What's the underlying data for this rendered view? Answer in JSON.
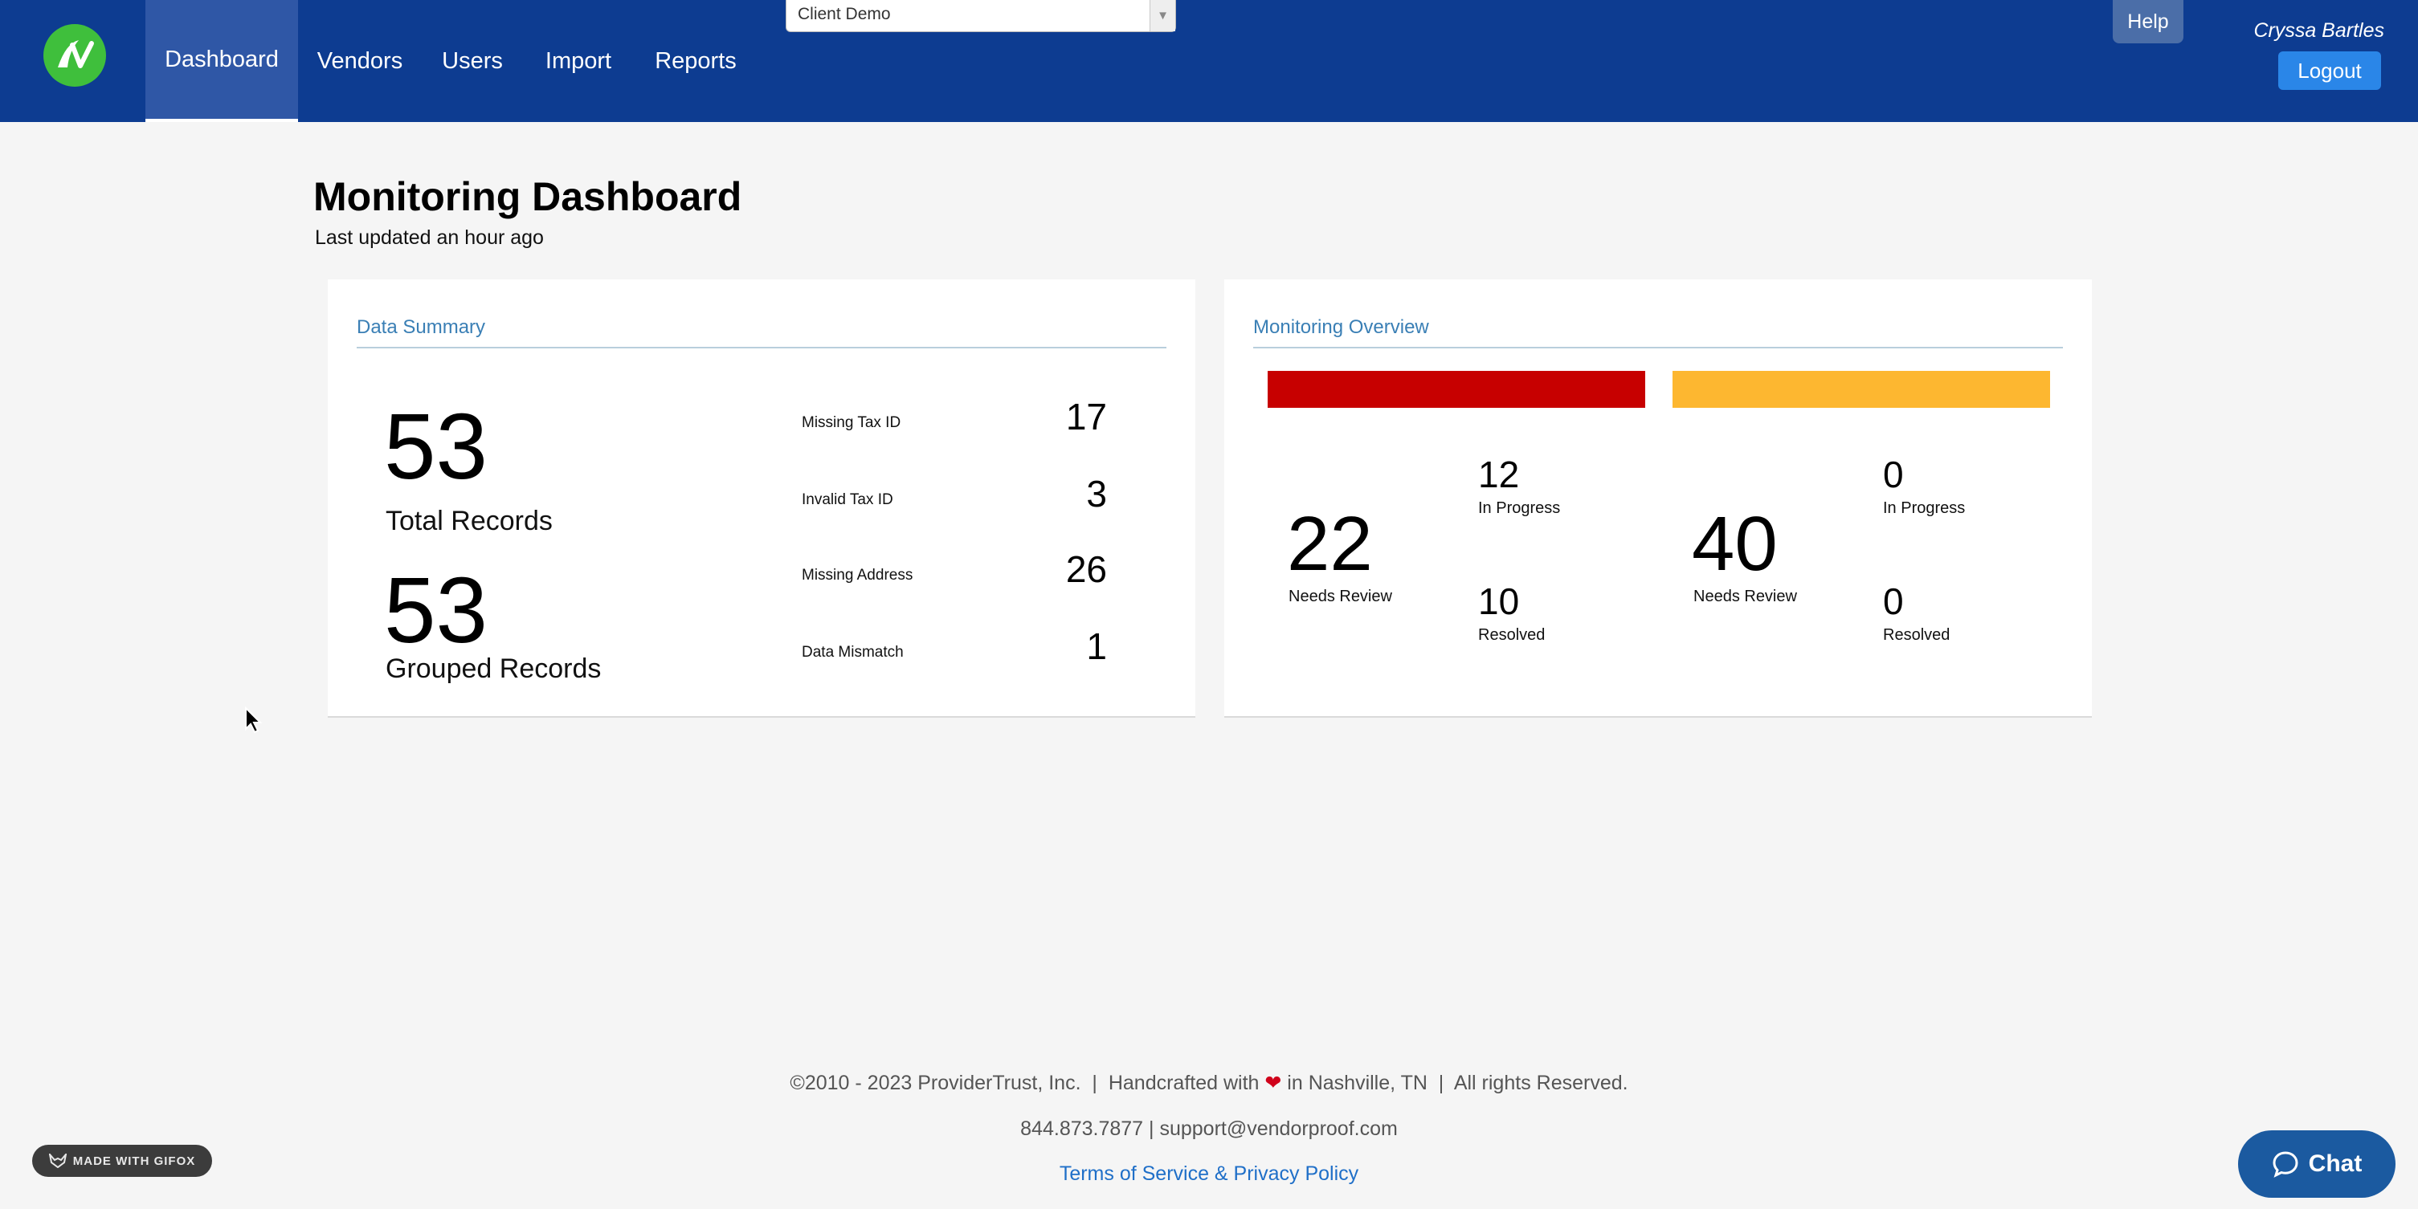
{
  "nav": {
    "items": [
      {
        "label": "Dashboard",
        "active": true
      },
      {
        "label": "Vendors",
        "active": false
      },
      {
        "label": "Users",
        "active": false
      },
      {
        "label": "Import",
        "active": false
      },
      {
        "label": "Reports",
        "active": false
      }
    ],
    "client_select": "Client Demo",
    "help": "Help",
    "user_name": "Cryssa Bartles",
    "logout": "Logout"
  },
  "header": {
    "title": "Monitoring Dashboard",
    "last_updated": "Last updated an hour ago"
  },
  "data_summary": {
    "title": "Data Summary",
    "total_records": "53",
    "total_records_label": "Total Records",
    "grouped_records": "53",
    "grouped_records_label": "Grouped Records",
    "stats": [
      {
        "label": "Missing Tax ID",
        "value": "17"
      },
      {
        "label": "Invalid Tax ID",
        "value": "3"
      },
      {
        "label": "Missing Address",
        "value": "26"
      },
      {
        "label": "Data Mismatch",
        "value": "1"
      }
    ]
  },
  "monitoring_overview": {
    "title": "Monitoring Overview",
    "colors": {
      "red": "#c70000",
      "yellow": "#fdb730"
    },
    "groups": [
      {
        "needs_review": "22",
        "needs_review_label": "Needs Review",
        "in_progress": "12",
        "in_progress_label": "In Progress",
        "resolved": "10",
        "resolved_label": "Resolved"
      },
      {
        "needs_review": "40",
        "needs_review_label": "Needs Review",
        "in_progress": "0",
        "in_progress_label": "In Progress",
        "resolved": "0",
        "resolved_label": "Resolved"
      }
    ]
  },
  "footer": {
    "copyright": "©2010 - 2023 ProviderTrust, Inc.",
    "handcrafted_pre": "Handcrafted with",
    "handcrafted_post": "in Nashville, TN",
    "rights": "All rights Reserved.",
    "contact": "844.873.7877 | support@vendorproof.com",
    "terms": "Terms of Service & Privacy Policy"
  },
  "gifox": "MADE WITH GIFOX",
  "chat": "Chat"
}
